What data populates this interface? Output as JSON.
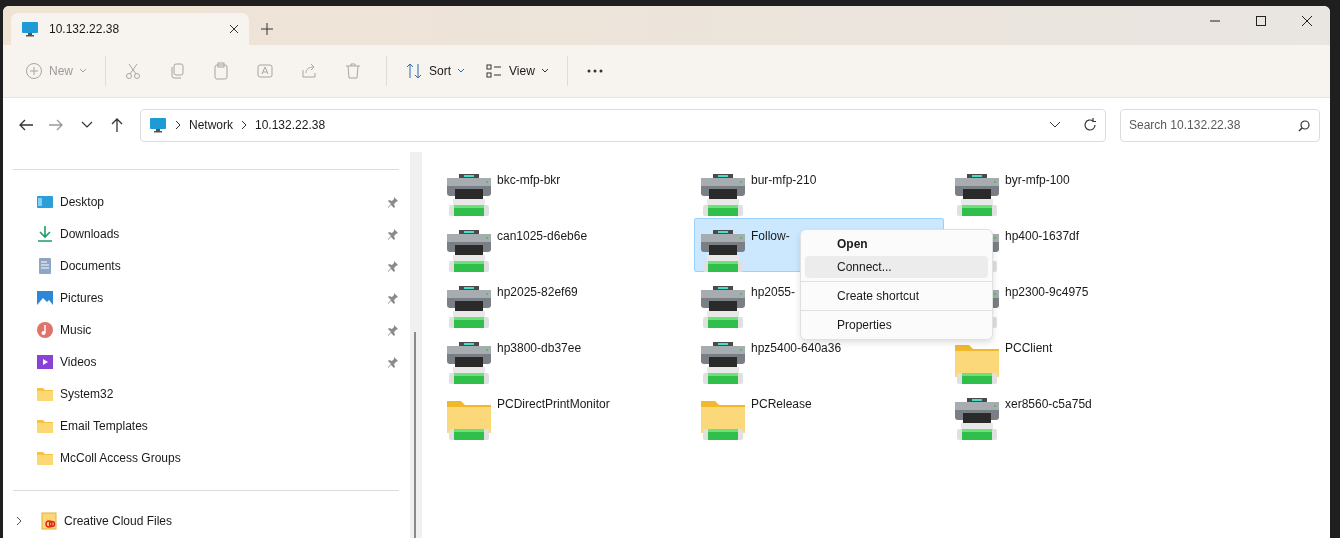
{
  "window": {
    "tab_title": "10.132.22.38"
  },
  "toolbar": [
    {
      "kind": "new",
      "label": "New",
      "disabled": true
    },
    {
      "kind": "cut",
      "disabled": true
    },
    {
      "kind": "copy",
      "disabled": true
    },
    {
      "kind": "paste",
      "disabled": true
    },
    {
      "kind": "rename",
      "disabled": true
    },
    {
      "kind": "share",
      "disabled": true
    },
    {
      "kind": "delete",
      "disabled": true
    },
    {
      "kind": "sort",
      "label": "Sort",
      "disabled": false
    },
    {
      "kind": "view",
      "label": "View",
      "disabled": false
    },
    {
      "kind": "more",
      "disabled": false
    }
  ],
  "address": {
    "crumbs": [
      "Network",
      "10.132.22.38"
    ],
    "search_placeholder": "Search 10.132.22.38"
  },
  "sidebar": {
    "items": [
      {
        "label": "Desktop",
        "kind": "desktop",
        "pinned": true
      },
      {
        "label": "Downloads",
        "kind": "downloads",
        "pinned": true
      },
      {
        "label": "Documents",
        "kind": "documents",
        "pinned": true
      },
      {
        "label": "Pictures",
        "kind": "pictures",
        "pinned": true
      },
      {
        "label": "Music",
        "kind": "music",
        "pinned": true
      },
      {
        "label": "Videos",
        "kind": "videos",
        "pinned": true
      },
      {
        "label": "System32",
        "kind": "folder",
        "pinned": false
      },
      {
        "label": "Email Templates",
        "kind": "folder",
        "pinned": false
      },
      {
        "label": "McColl Access Groups",
        "kind": "folder",
        "pinned": false
      }
    ],
    "bottom_items": [
      {
        "label": "Creative Cloud Files",
        "kind": "cloud",
        "expanded": false
      }
    ]
  },
  "items": [
    {
      "name": "bkc-mfp-bkr",
      "kind": "printer",
      "selected": false
    },
    {
      "name": "bur-mfp-210",
      "kind": "printer",
      "selected": false
    },
    {
      "name": "byr-mfp-100",
      "kind": "printer",
      "selected": false
    },
    {
      "name": "can1025-d6eb6e",
      "kind": "printer",
      "selected": false
    },
    {
      "name": "Follow-",
      "kind": "printer",
      "selected": true
    },
    {
      "name": "hp400-1637df",
      "kind": "printer",
      "selected": false
    },
    {
      "name": "hp2025-82ef69",
      "kind": "printer",
      "selected": false
    },
    {
      "name": "hp2055-",
      "kind": "printer",
      "selected": false
    },
    {
      "name": "hp2300-9c4975",
      "kind": "printer",
      "selected": false
    },
    {
      "name": "hp3800-db37ee",
      "kind": "printer",
      "selected": false
    },
    {
      "name": "hpz5400-640a36",
      "kind": "printer",
      "selected": false
    },
    {
      "name": "PCClient",
      "kind": "folder",
      "selected": false
    },
    {
      "name": "PCDirectPrintMonitor",
      "kind": "folder",
      "selected": false
    },
    {
      "name": "PCRelease",
      "kind": "folder",
      "selected": false
    },
    {
      "name": "xer8560-c5a75d",
      "kind": "printer",
      "selected": false
    }
  ],
  "context_menu": [
    {
      "label": "Open",
      "default": true,
      "highlighted": false
    },
    {
      "label": "Connect...",
      "default": false,
      "highlighted": true
    },
    {
      "kind": "separator"
    },
    {
      "label": "Create shortcut",
      "default": false,
      "highlighted": false
    },
    {
      "kind": "separator"
    },
    {
      "label": "Properties",
      "default": false,
      "highlighted": false
    }
  ]
}
